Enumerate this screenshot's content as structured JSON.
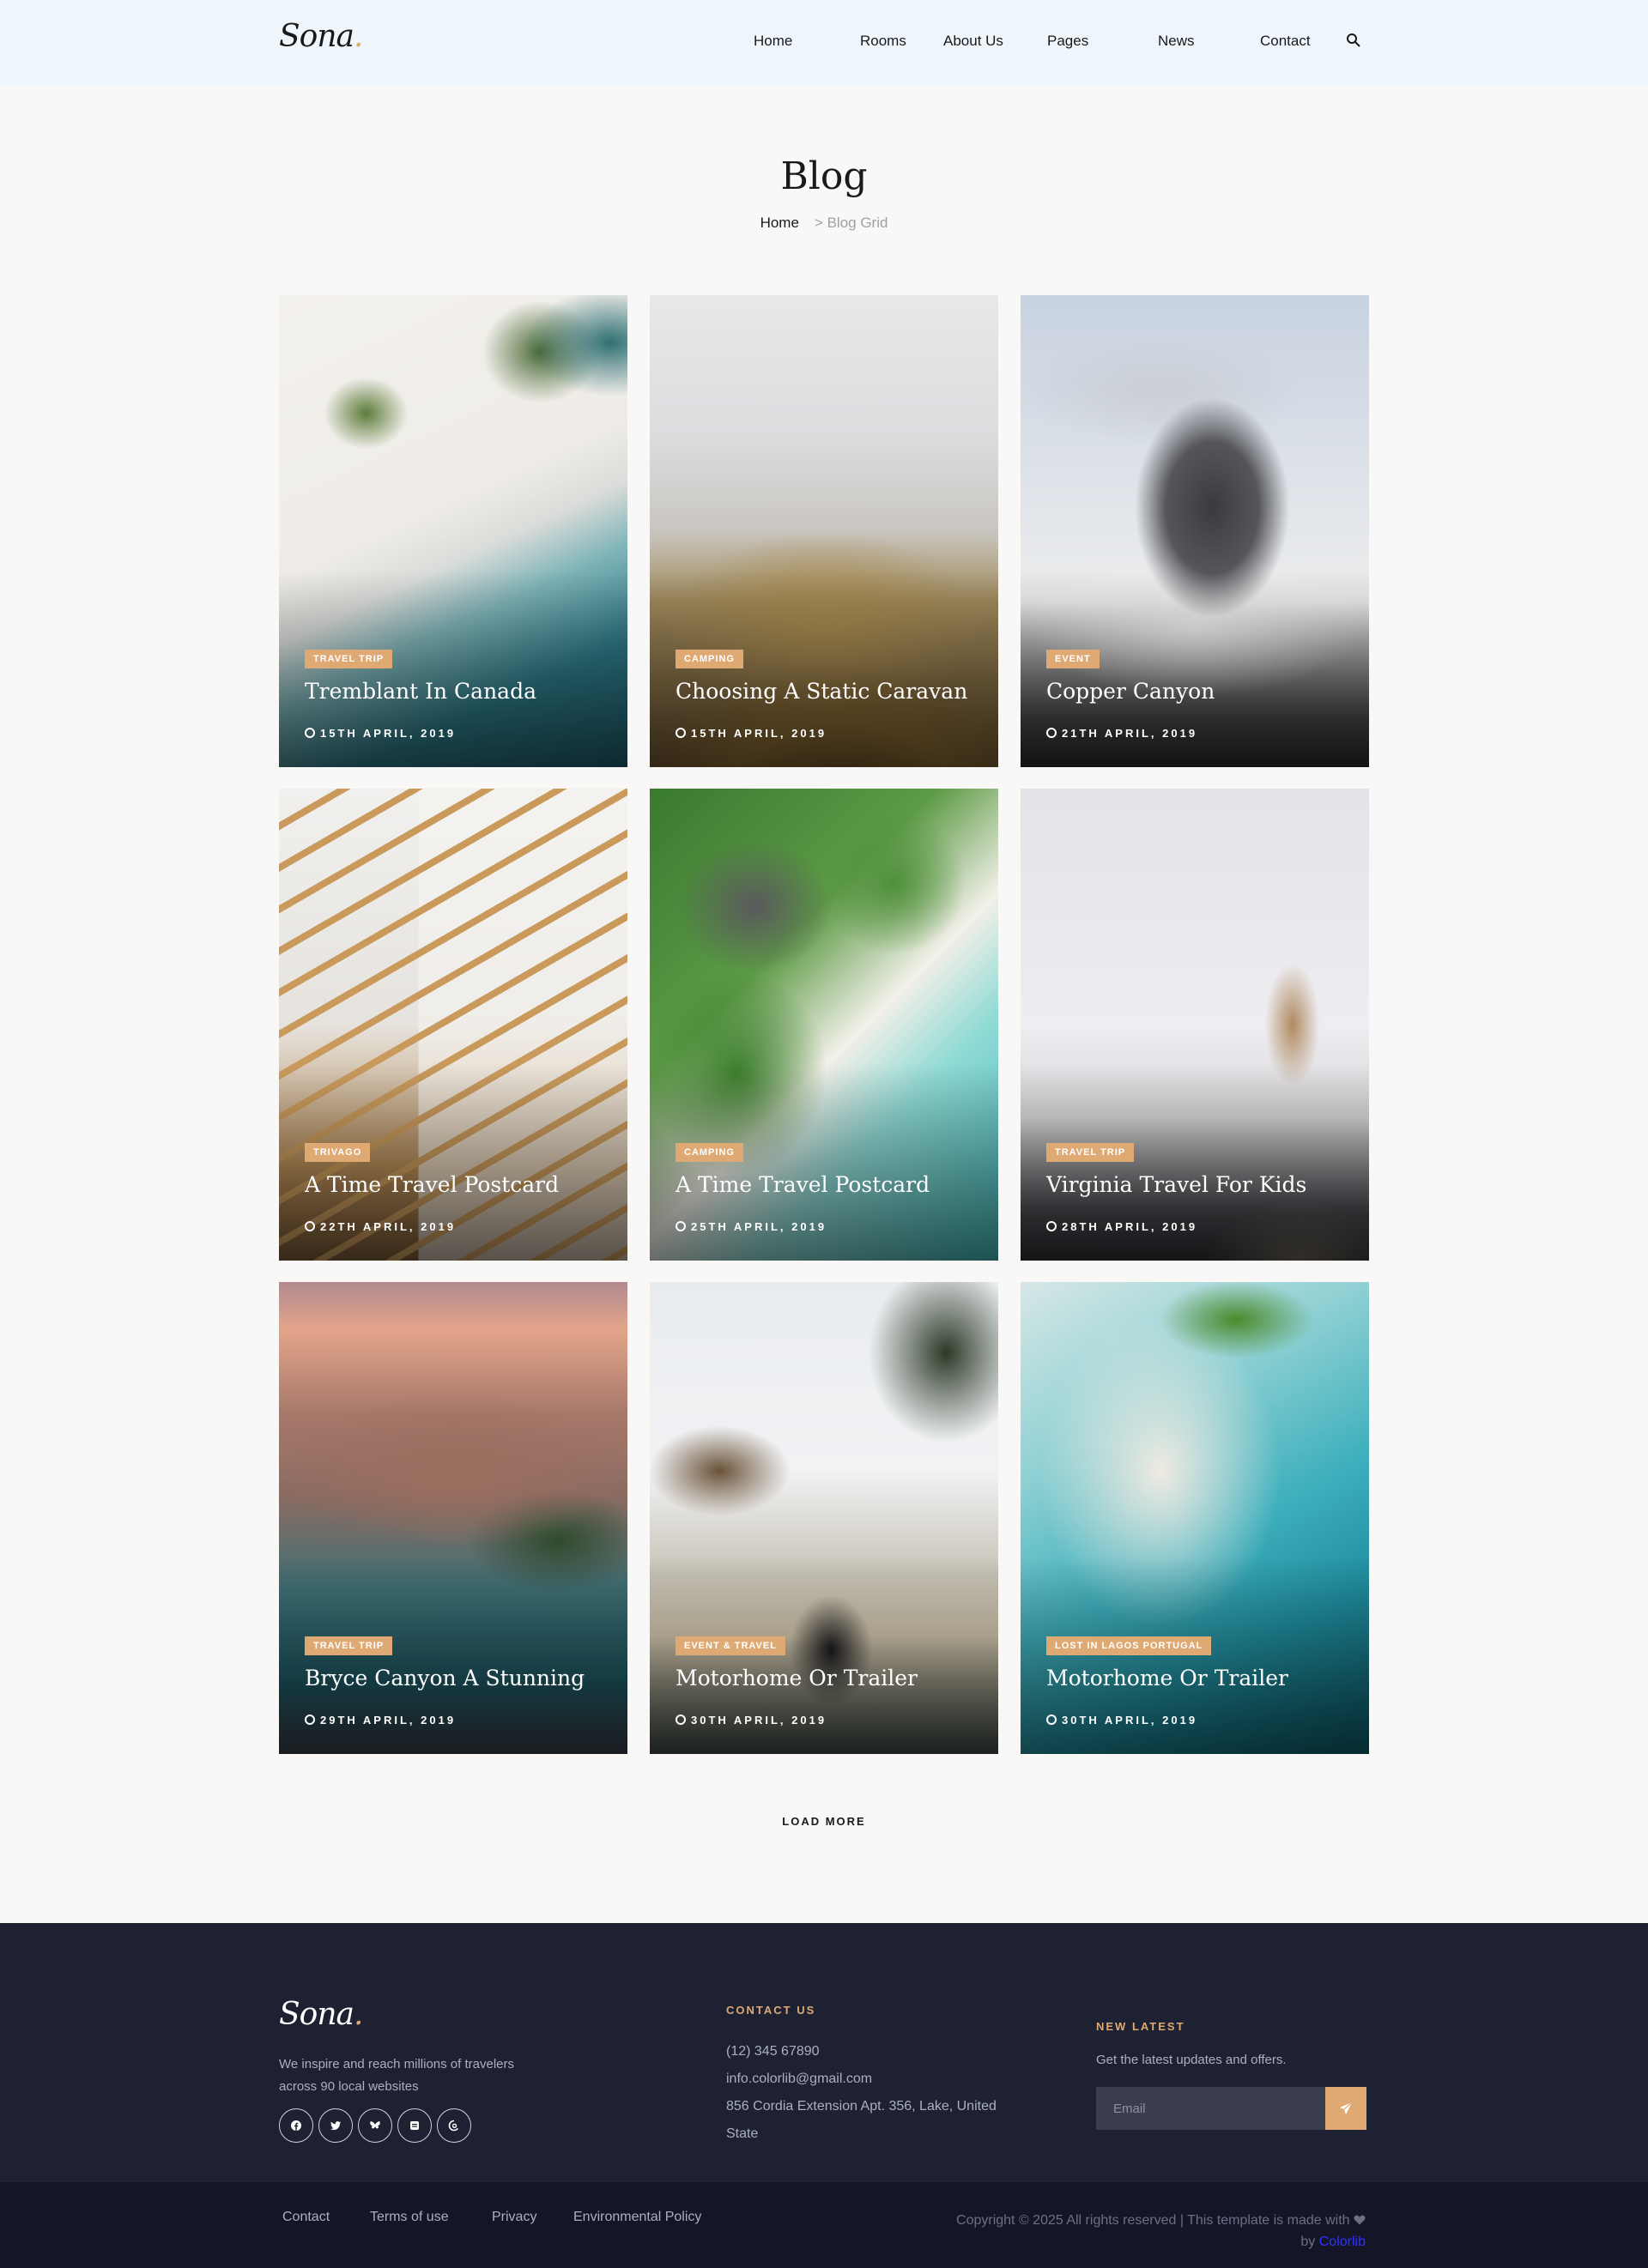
{
  "header": {
    "logo": "Sona",
    "logo_dot": ".",
    "nav": [
      "Home",
      "Rooms",
      "About Us",
      "Pages",
      "News",
      "Contact"
    ]
  },
  "breadcrumb": {
    "title": "Blog",
    "home": "Home",
    "current": "> Blog Grid"
  },
  "posts": [
    {
      "tag": "Travel Trip",
      "title": "Tremblant In Canada",
      "date": "15th April, 2019"
    },
    {
      "tag": "Camping",
      "title": "Choosing A Static Caravan",
      "date": "15th April, 2019"
    },
    {
      "tag": "Event",
      "title": "Copper Canyon",
      "date": "21th April, 2019"
    },
    {
      "tag": "Trivago",
      "title": "A Time Travel Postcard",
      "date": "22th April, 2019"
    },
    {
      "tag": "Camping",
      "title": "A Time Travel Postcard",
      "date": "25th April, 2019"
    },
    {
      "tag": "Travel Trip",
      "title": "Virginia Travel For Kids",
      "date": "28th April, 2019"
    },
    {
      "tag": "Travel Trip",
      "title": "Bryce Canyon A Stunning",
      "date": "29th April, 2019"
    },
    {
      "tag": "Event & Travel",
      "title": "Motorhome Or Trailer",
      "date": "30th April, 2019"
    },
    {
      "tag": "Lost In Lagos Portugal",
      "title": "Motorhome Or Trailer",
      "date": "30th April, 2019"
    }
  ],
  "load_more": "LOAD MORE",
  "footer": {
    "logo": "Sona",
    "logo_dot": ".",
    "about": "We inspire and reach millions of travelers across 90 local websites",
    "contact_heading": "CONTACT US",
    "phone": "(12) 345 67890",
    "email": "info.colorlib@gmail.com",
    "address": "856 Cordia Extension Apt. 356, Lake, United State",
    "news_heading": "NEW LATEST",
    "news_text": "Get the latest updates and offers.",
    "email_placeholder": "Email",
    "links": [
      "Contact",
      "Terms of use",
      "Privacy",
      "Environmental Policy"
    ],
    "copyright": "Copyright © 2025 All rights reserved | This template is made with",
    "copyright_by": "by",
    "copyright_brand": "Colorlib"
  },
  "colors": {
    "accent": "#dfa974",
    "footer_bg": "#1e2131",
    "bottom_bg": "#141628",
    "header_bg": "#eef6fc"
  }
}
